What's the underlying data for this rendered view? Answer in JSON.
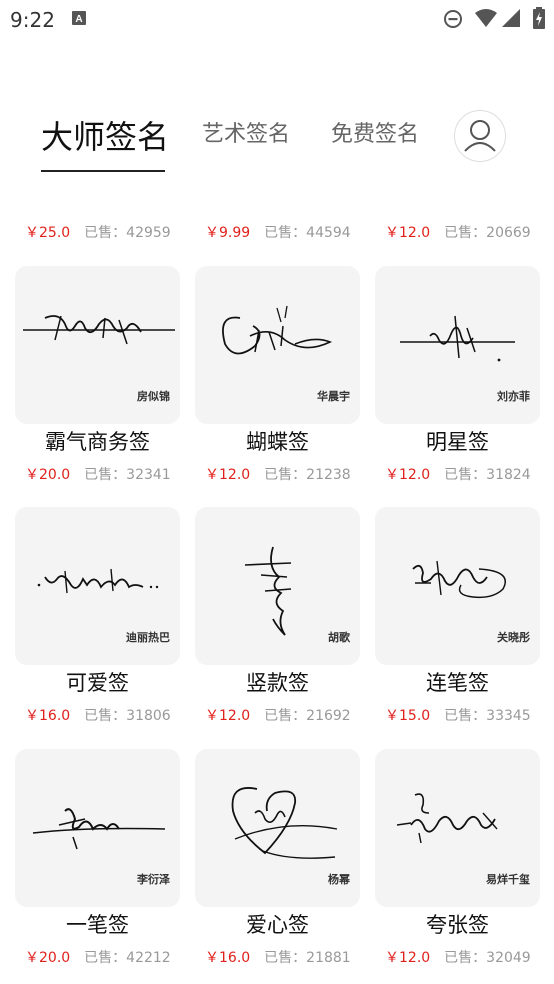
{
  "status_bar": {
    "time": "9:22"
  },
  "tabs": [
    {
      "label": "大师签名",
      "active": true
    },
    {
      "label": "艺术签名",
      "active": false
    },
    {
      "label": "免费签名",
      "active": false
    }
  ],
  "top_prices": [
    {
      "price": "￥25.0",
      "sold": "已售：42959"
    },
    {
      "price": "￥9.99",
      "sold": "已售：44594"
    },
    {
      "price": "￥12.0",
      "sold": "已售：20669"
    }
  ],
  "products": [
    {
      "name": "房似锦",
      "title": "霸气商务签",
      "price": "￥20.0",
      "sold": "已售：32341"
    },
    {
      "name": "华晨宇",
      "title": "蝴蝶签",
      "price": "￥12.0",
      "sold": "已售：21238"
    },
    {
      "name": "刘亦菲",
      "title": "明星签",
      "price": "￥12.0",
      "sold": "已售：31824"
    },
    {
      "name": "迪丽热巴",
      "title": "可爱签",
      "price": "￥16.0",
      "sold": "已售：31806"
    },
    {
      "name": "胡歌",
      "title": "竖款签",
      "price": "￥12.0",
      "sold": "已售：21692"
    },
    {
      "name": "关晓彤",
      "title": "连笔签",
      "price": "￥15.0",
      "sold": "已售：33345"
    },
    {
      "name": "李衍泽",
      "title": "一笔签",
      "price": "￥20.0",
      "sold": "已售：42212"
    },
    {
      "name": "杨幂",
      "title": "爱心签",
      "price": "￥16.0",
      "sold": "已售：21881"
    },
    {
      "name": "易烊千玺",
      "title": "夸张签",
      "price": "￥12.0",
      "sold": "已售：32049"
    }
  ],
  "colors": {
    "price": "#e0211b",
    "sold": "#999999",
    "card_bg": "#f4f4f4"
  },
  "icons": [
    "notification-a-icon",
    "do-not-disturb-icon",
    "wifi-icon",
    "signal-icon",
    "battery-icon",
    "user-avatar-icon"
  ]
}
